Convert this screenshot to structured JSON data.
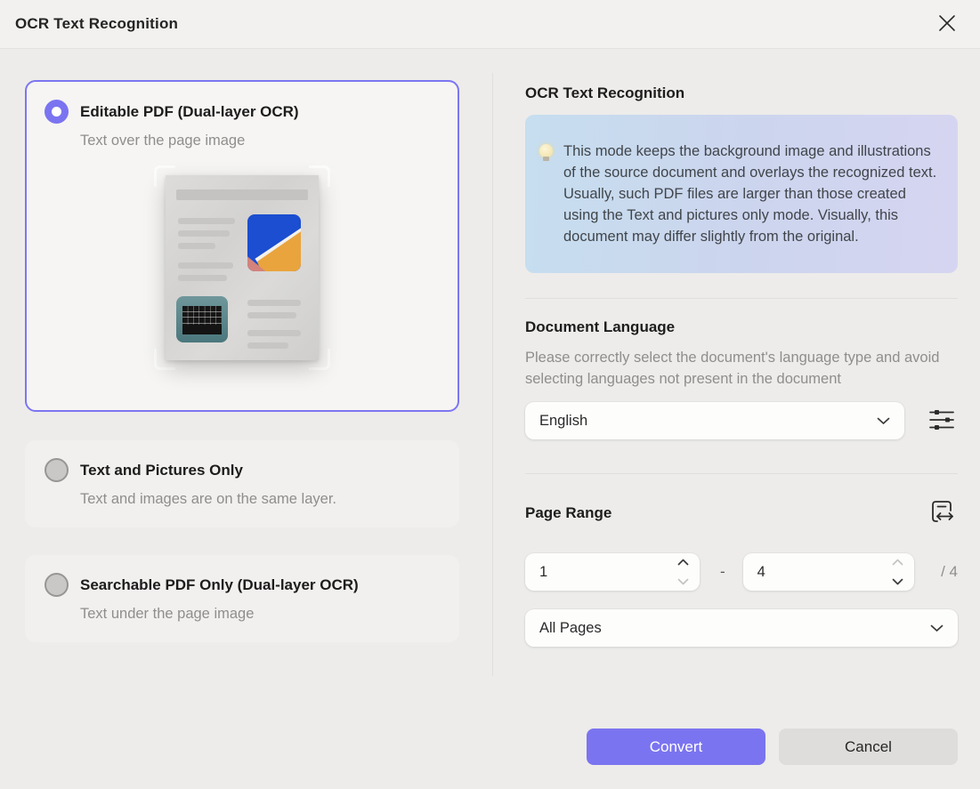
{
  "dialog": {
    "title": "OCR Text Recognition"
  },
  "options": [
    {
      "label": "Editable PDF (Dual-layer OCR)",
      "description": "Text over the page image",
      "selected": true
    },
    {
      "label": "Text and Pictures Only",
      "description": "Text and images are on the same layer.",
      "selected": false
    },
    {
      "label": "Searchable PDF Only (Dual-layer OCR)",
      "description": "Text under the page image",
      "selected": false
    }
  ],
  "mode_info": {
    "heading": "OCR Text Recognition",
    "tip": "This mode keeps the background image and illustrations of the source document and overlays the recognized text. Usually, such PDF files are larger than those created using the Text and pictures only mode. Visually, this document may differ slightly from the original."
  },
  "language": {
    "heading": "Document Language",
    "description": "Please correctly select the document's language type and avoid selecting languages not present in the document",
    "selected": "English"
  },
  "page_range": {
    "heading": "Page Range",
    "from": "1",
    "separator": "-",
    "to": "4",
    "total": "/ 4",
    "mode": "All Pages"
  },
  "footer": {
    "convert": "Convert",
    "cancel": "Cancel"
  },
  "icons": [
    "close-icon",
    "lightbulb-icon",
    "chevron-down-icon",
    "spinner-up-icon",
    "spinner-down-icon",
    "language-settings-sliders-icon",
    "page-range-icon"
  ],
  "colors": {
    "accent": "#7b74f0",
    "info_gradient_start": "#c6deef",
    "info_gradient_end": "#d6d5f1",
    "cancel_gray": "#dedddb"
  }
}
